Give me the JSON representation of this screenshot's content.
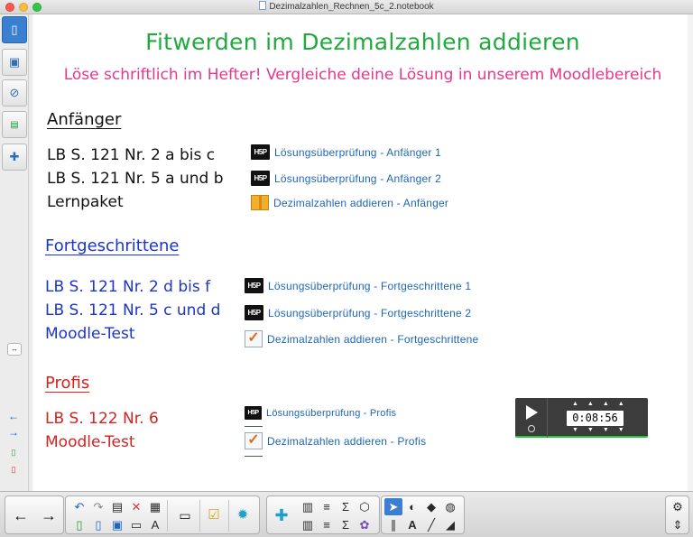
{
  "window": {
    "title": "Dezimalzahlen_Rechnen_5c_2.notebook"
  },
  "side_panel": {
    "tabs": [
      {
        "name": "page-sorter",
        "icon": "page-icon"
      },
      {
        "name": "gallery",
        "icon": "image-icon"
      },
      {
        "name": "attachments",
        "icon": "paperclip-icon"
      },
      {
        "name": "properties",
        "icon": "properties-icon"
      },
      {
        "name": "addons",
        "icon": "puzzle-icon"
      }
    ],
    "resize_icon": "↔",
    "bottom_icons": [
      "arrow-left-icon",
      "arrow-right-icon",
      "page-add-icon",
      "page-delete-icon"
    ]
  },
  "page": {
    "title": "Fitwerden im Dezimalzahlen addieren",
    "subtitle": "Löse schriftlich im Hefter! Vergleiche deine Lösung in unserem Moodlebereich",
    "sections": [
      {
        "heading": "Anfänger",
        "tasks": [
          "LB S. 121 Nr. 2 a bis c",
          "LB S. 121 Nr. 5 a und b",
          "Lernpaket"
        ],
        "links": [
          {
            "icon": "H5P",
            "label": "Lösungsüberprüfung - Anfänger 1"
          },
          {
            "icon": "H5P",
            "label": "Lösungsüberprüfung - Anfänger 2"
          },
          {
            "icon": "package",
            "label": "Dezimalzahlen addieren - Anfänger"
          }
        ]
      },
      {
        "heading": "Fortgeschrittene",
        "tasks": [
          "LB S. 121 Nr. 2 d bis f",
          "LB S. 121 Nr. 5 c und d",
          "Moodle-Test"
        ],
        "links": [
          {
            "icon": "H5P",
            "label": "Lösungsüberprüfung - Fortgeschrittene 1"
          },
          {
            "icon": "H5P",
            "label": "Lösungsüberprüfung - Fortgeschrittene 2"
          },
          {
            "icon": "quiz",
            "label": "Dezimalzahlen addieren - Fortgeschrittene"
          }
        ]
      },
      {
        "heading": "Profis",
        "tasks": [
          "LB S. 122 Nr. 6",
          "Moodle-Test"
        ],
        "links": [
          {
            "icon": "H5P",
            "label": "Lösungsüberprüfung - Profis"
          },
          {
            "icon": "quiz",
            "label": "Dezimalzahlen addieren - Profis"
          }
        ]
      }
    ]
  },
  "timer": {
    "time": "0:08:56",
    "play_icon": "play-icon",
    "reset_icon": "reset-icon"
  },
  "colors": {
    "title": "#1faa3c",
    "subtitle": "#e8368f",
    "beginner": "#111111",
    "advanced": "#1b35c8",
    "pro": "#d32222",
    "link": "#1c66b8"
  },
  "toolbar": {
    "groups": [
      [
        "previous-page-icon",
        "next-page-icon"
      ],
      [
        "undo-icon",
        "redo-icon",
        "paste-icon",
        "delete-icon",
        "table-icon",
        "new-page-icon",
        "open-icon",
        "save-icon",
        "screen-shade-icon",
        "spell-check-icon",
        "display-icon",
        "response-icon",
        "addon-icon"
      ],
      [
        "puzzle-icon",
        "chart-icon",
        "align-icon",
        "sum-icon",
        "shape-icon",
        "chart-2-icon",
        "align-2-icon",
        "sum-2-icon",
        "flower-icon"
      ],
      [
        "select-icon",
        "shapes-icon",
        "eraser-fill-icon",
        "fill-icon",
        "pens-icon",
        "text-icon",
        "line-icon",
        "eraser-icon"
      ],
      [
        "settings-icon",
        "move-toolbar-icon"
      ]
    ]
  }
}
